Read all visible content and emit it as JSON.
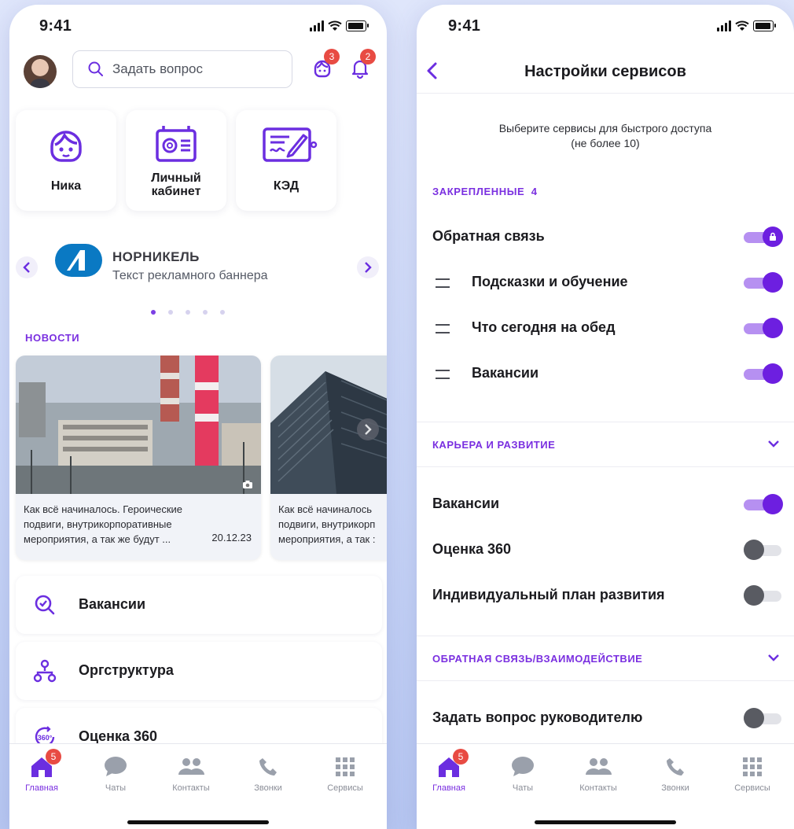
{
  "colors": {
    "accent": "#7a2fe0",
    "badge": "#e84b43"
  },
  "left": {
    "time": "9:41",
    "search_placeholder": "Задать вопрос",
    "bot_badge": "3",
    "bell_badge": "2",
    "tiles": [
      {
        "label": "Ника",
        "icon": "nika-bot-icon"
      },
      {
        "label": "Личный\nкабинет",
        "icon": "profile-card-icon"
      },
      {
        "label": "КЭД",
        "icon": "signed-document-icon"
      }
    ],
    "banner": {
      "brand": "НОРНИКЕЛЬ",
      "text": "Текст рекламного баннера",
      "slides": 5,
      "active_slide": 1
    },
    "news_title": "НОВОСТИ",
    "news": [
      {
        "text_line1": "Как всё начиналось. Героические",
        "text_line2": "подвиги, внутрикорпоративные",
        "text_line3": "мероприятия, а так же будут ...",
        "date": "20.12.23"
      },
      {
        "text_line1": "Как всё начиналось",
        "text_line2": "подвиги, внутрикорп",
        "text_line3": "мероприятия, а так :",
        "date": ""
      }
    ],
    "list": [
      {
        "label": "Вакансии",
        "icon": "search-check-icon"
      },
      {
        "label": "Оргструктура",
        "icon": "org-structure-icon"
      },
      {
        "label": "Оценка 360",
        "icon": "rating-360-icon"
      }
    ]
  },
  "right": {
    "time": "9:41",
    "title": "Настройки сервисов",
    "hint_line1": "Выберите сервисы для быстрого доступа",
    "hint_line2": "(не более 10)",
    "pinned_label": "ЗАКРЕПЛЕННЫЕ",
    "pinned_count": "4",
    "pinned": [
      {
        "label": "Обратная связь",
        "on": true,
        "locked": true
      },
      {
        "label": "Подсказки и обучение",
        "on": true
      },
      {
        "label": "Что сегодня на обед",
        "on": true
      },
      {
        "label": "Вакансии",
        "on": true
      }
    ],
    "career_label": "КАРЬЕРА И РАЗВИТИЕ",
    "career": [
      {
        "label": "Вакансии",
        "on": true
      },
      {
        "label": "Оценка 360",
        "on": false
      },
      {
        "label": "Индивидуальный план развития",
        "on": false
      }
    ],
    "feedback_label": "ОБРАТНАЯ СВЯЗЬ/ВЗАИМОДЕЙСТВИЕ",
    "feedback": [
      {
        "label": "Задать вопрос руководителю",
        "on": false
      }
    ]
  },
  "tabbar": {
    "home_badge": "5",
    "tabs": [
      "Главная",
      "Чаты",
      "Контакты",
      "Звонки",
      "Сервисы"
    ]
  }
}
